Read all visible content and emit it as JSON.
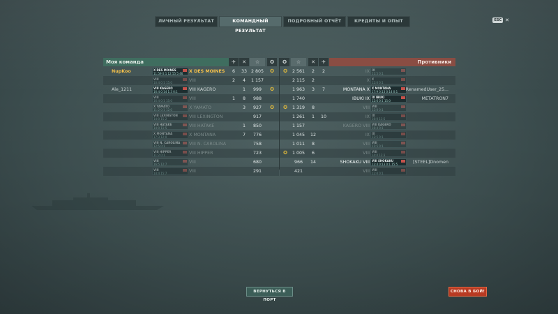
{
  "tabs": [
    "ЛИЧНЫЙ РЕЗУЛЬТАТ",
    "КОМАНДНЫЙ РЕЗУЛЬТАТ",
    "ПОДРОБНЫЙ ОТЧЁТ",
    "КРЕДИТЫ И ОПЫТ"
  ],
  "active_tab": 1,
  "corner": {
    "esc": "ESC",
    "close": "✕"
  },
  "my_team": {
    "title": "Моя команда",
    "rows": [
      {
        "player": "NupKoo",
        "card_tier": "X DES MOINES",
        "card_stats": "11:59 0:1 12:55 5:46",
        "tier": "X",
        "ship": "DES MOINES",
        "kills": "6",
        "planes": "33",
        "xp": "2 805",
        "medal": "✪",
        "self": true
      },
      {
        "player": "",
        "card_tier": "VIII",
        "card_stats": "10:4 0:1 15:0",
        "tier": "VIII",
        "ship": "",
        "kills": "2",
        "planes": "4",
        "xp": "1 157",
        "medal": "",
        "faded": true
      },
      {
        "player": "Ale_1211",
        "card_tier": "VIII KAGERO",
        "card_stats": "16:4 0:14 1:3 0:1",
        "tier": "VIII",
        "ship": "KAGERO",
        "kills": "",
        "planes": "1",
        "xp": "999",
        "medal": "✪"
      },
      {
        "player": "",
        "card_tier": "VIII",
        "card_stats": "16:4 0:1 15:0",
        "tier": "VIII",
        "ship": "",
        "kills": "1",
        "planes": "8",
        "xp": "988",
        "medal": "",
        "faded": true
      },
      {
        "player": "",
        "card_tier": "X YAMATO",
        "card_stats": "11:2 0:1 12:0",
        "tier": "X",
        "ship": "YAMATO",
        "kills": "",
        "planes": "3",
        "xp": "927",
        "medal": "✪",
        "faded": true
      },
      {
        "player": "",
        "card_tier": "VIII LEXINGTON",
        "card_stats": "14:0 15:2",
        "tier": "VIII",
        "ship": "LEXINGTON",
        "kills": "",
        "planes": "",
        "xp": "917",
        "medal": "",
        "faded": true
      },
      {
        "player": "",
        "card_tier": "VIII HATAKE",
        "card_stats": "14:0 11:5",
        "tier": "VIII",
        "ship": "HATAKE",
        "kills": "",
        "planes": "1",
        "xp": "850",
        "medal": "",
        "faded": true
      },
      {
        "player": "",
        "card_tier": "X MONTANA",
        "card_stats": "17:3 12:0",
        "tier": "X",
        "ship": "MONTANA",
        "kills": "",
        "planes": "7",
        "xp": "776",
        "medal": "",
        "faded": true
      },
      {
        "player": "",
        "card_tier": "VIII N. CAROLINA",
        "card_stats": "12:5 0:1",
        "tier": "VIII",
        "ship": "N. CAROLINA",
        "kills": "",
        "planes": "",
        "xp": "758",
        "medal": "",
        "faded": true
      },
      {
        "player": "",
        "card_tier": "VIII HIPPER",
        "card_stats": "11:2 0:1",
        "tier": "VIII",
        "ship": "HIPPER",
        "kills": "",
        "planes": "",
        "xp": "723",
        "medal": "",
        "faded": true
      },
      {
        "player": "",
        "card_tier": "VIII",
        "card_stats": "16:5 12:7",
        "tier": "VIII",
        "ship": "",
        "kills": "",
        "planes": "",
        "xp": "680",
        "medal": "",
        "faded": true
      },
      {
        "player": "",
        "card_tier": "VIII",
        "card_stats": "14:4 15:7",
        "tier": "VIII",
        "ship": "",
        "kills": "",
        "planes": "",
        "xp": "291",
        "medal": "",
        "faded": true
      }
    ]
  },
  "enemy_team": {
    "title": "Противники",
    "rows": [
      {
        "player": "",
        "card_tier": "IX",
        "card_stats": "11:5 0:1",
        "tier": "IX",
        "ship": "",
        "kills": "2",
        "planes": "2",
        "xp": "2 561",
        "medal": "✪",
        "faded": true
      },
      {
        "player": "",
        "card_tier": "X",
        "card_stats": "12:0 0:1",
        "tier": "X",
        "ship": "",
        "kills": "2",
        "planes": "",
        "xp": "2 115",
        "medal": "",
        "faded": true
      },
      {
        "player": "RenamedUser_25...",
        "card_tier": "X MONTANA",
        "card_stats": "17:9 0:13 0:14 0:1",
        "tier": "X",
        "ship": "MONTANA",
        "kills": "3",
        "planes": "7",
        "xp": "1 963",
        "medal": "",
        "bright": true
      },
      {
        "player": "METATRON7",
        "card_tier": "IX IBUKI",
        "card_stats": "12:6 0:1 15:0",
        "tier": "IX",
        "ship": "IBUKI",
        "kills": "",
        "planes": "",
        "xp": "1 740",
        "medal": "",
        "bright": true
      },
      {
        "player": "",
        "card_tier": "VIII",
        "card_stats": "12:0 0:1",
        "tier": "VIII",
        "ship": "",
        "kills": "8",
        "planes": "",
        "xp": "1 319",
        "medal": "✪",
        "faded": true
      },
      {
        "player": "",
        "card_tier": "IX",
        "card_stats": "16:0 11:5",
        "tier": "IX",
        "ship": "",
        "kills": "1",
        "planes": "10",
        "xp": "1 261",
        "medal": "",
        "faded": true
      },
      {
        "player": "",
        "card_tier": "VIII KAGERO",
        "card_stats": "16:4 0:1",
        "tier": "VIII",
        "ship": "KAGERO",
        "kills": "",
        "planes": "",
        "xp": "1 157",
        "medal": "",
        "faded": true
      },
      {
        "player": "",
        "card_tier": "IX",
        "card_stats": "12:5 0:1",
        "tier": "IX",
        "ship": "",
        "kills": "12",
        "planes": "",
        "xp": "1 045",
        "medal": "",
        "faded": true
      },
      {
        "player": "",
        "card_tier": "VIII",
        "card_stats": "11:5 0:1",
        "tier": "VIII",
        "ship": "",
        "kills": "8",
        "planes": "",
        "xp": "1 011",
        "medal": "",
        "faded": true
      },
      {
        "player": "",
        "card_tier": "VIII",
        "card_stats": "14:0 12:3",
        "tier": "VIII",
        "ship": "",
        "kills": "6",
        "planes": "",
        "xp": "1 005",
        "medal": "✪",
        "faded": true
      },
      {
        "player": "[STEEL]Dnomen",
        "card_tier": "VIII SHOKAKU",
        "card_stats": "12:4 0:13 0:1 15:5",
        "tier": "VIII",
        "ship": "SHOKAKU",
        "kills": "14",
        "planes": "",
        "xp": "966",
        "medal": "",
        "bright": true
      },
      {
        "player": "",
        "card_tier": "VIII",
        "card_stats": "12:0 0:1",
        "tier": "VIII",
        "ship": "",
        "kills": "",
        "planes": "",
        "xp": "421",
        "medal": "",
        "faded": true
      }
    ]
  },
  "header_icons": {
    "plane": "✈",
    "kill": "✕",
    "star": "☆",
    "medal": "✪"
  },
  "buttons": {
    "port": "ВЕРНУТЬСЯ В ПОРТ",
    "battle": "СНОВА В БОЙ!"
  }
}
